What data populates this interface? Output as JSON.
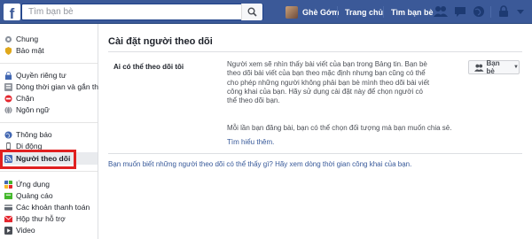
{
  "topbar": {
    "logo": "f",
    "search_placeholder": "Tìm bạn bè",
    "user_name": "Ghè Gớm",
    "home_label": "Trang chủ",
    "find_friends_label": "Tìm bạn bè"
  },
  "sidebar": {
    "items": [
      {
        "label": "Chung",
        "icon": "gear-icon"
      },
      {
        "label": "Bảo mật",
        "icon": "shield-icon"
      },
      {
        "label": "Quyền riêng tư",
        "icon": "lock-icon"
      },
      {
        "label": "Dòng thời gian và gắn th...",
        "icon": "timeline-icon"
      },
      {
        "label": "Chặn",
        "icon": "block-icon"
      },
      {
        "label": "Ngôn ngữ",
        "icon": "globe-icon"
      },
      {
        "label": "Thông báo",
        "icon": "globe-notify-icon"
      },
      {
        "label": "Di động",
        "icon": "mobile-icon"
      },
      {
        "label": "Người theo dõi",
        "icon": "rss-icon"
      },
      {
        "label": "Ứng dụng",
        "icon": "apps-icon"
      },
      {
        "label": "Quảng cáo",
        "icon": "ads-icon"
      },
      {
        "label": "Các khoản thanh toán",
        "icon": "card-icon"
      },
      {
        "label": "Hộp thư hỗ trợ",
        "icon": "support-icon"
      },
      {
        "label": "Video",
        "icon": "video-icon"
      }
    ]
  },
  "main": {
    "title": "Cài đặt người theo dõi",
    "row_label": "Ai có thể theo dõi tôi",
    "description": "Người xem sẽ nhìn thấy bài viết của bạn trong Bảng tin. Bạn bè theo dõi bài viết của bạn theo mặc định nhưng bạn cũng có thể cho phép những người không phải bạn bè mình theo dõi bài viết công khai của bạn. Hãy sử dụng cài đặt này để chọn người có thể theo dõi bạn.",
    "description2": "Mỗi lần bạn đăng bài, bạn có thể chọn đối tượng mà bạn muốn chia sẻ.",
    "learn_more": "Tìm hiểu thêm.",
    "dropdown_value": "Bạn bè",
    "footer_note": "Bạn muốn biết những người theo dõi có thể thấy gì? Hãy xem dòng thời gian công khai của bạn."
  },
  "colors": {
    "brand": "#3b5998",
    "highlight_box": "#e02020",
    "link": "#365899"
  }
}
